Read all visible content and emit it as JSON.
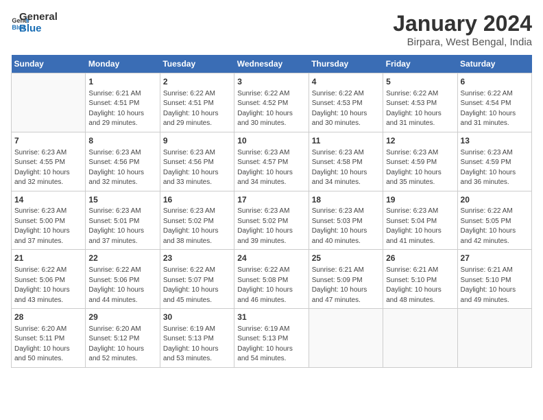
{
  "logo": {
    "line1": "General",
    "line2": "Blue"
  },
  "title": "January 2024",
  "subtitle": "Birpara, West Bengal, India",
  "days_of_week": [
    "Sunday",
    "Monday",
    "Tuesday",
    "Wednesday",
    "Thursday",
    "Friday",
    "Saturday"
  ],
  "weeks": [
    [
      {
        "day": "",
        "info": ""
      },
      {
        "day": "1",
        "info": "Sunrise: 6:21 AM\nSunset: 4:51 PM\nDaylight: 10 hours\nand 29 minutes."
      },
      {
        "day": "2",
        "info": "Sunrise: 6:22 AM\nSunset: 4:51 PM\nDaylight: 10 hours\nand 29 minutes."
      },
      {
        "day": "3",
        "info": "Sunrise: 6:22 AM\nSunset: 4:52 PM\nDaylight: 10 hours\nand 30 minutes."
      },
      {
        "day": "4",
        "info": "Sunrise: 6:22 AM\nSunset: 4:53 PM\nDaylight: 10 hours\nand 30 minutes."
      },
      {
        "day": "5",
        "info": "Sunrise: 6:22 AM\nSunset: 4:53 PM\nDaylight: 10 hours\nand 31 minutes."
      },
      {
        "day": "6",
        "info": "Sunrise: 6:22 AM\nSunset: 4:54 PM\nDaylight: 10 hours\nand 31 minutes."
      }
    ],
    [
      {
        "day": "7",
        "info": "Sunrise: 6:23 AM\nSunset: 4:55 PM\nDaylight: 10 hours\nand 32 minutes."
      },
      {
        "day": "8",
        "info": "Sunrise: 6:23 AM\nSunset: 4:56 PM\nDaylight: 10 hours\nand 32 minutes."
      },
      {
        "day": "9",
        "info": "Sunrise: 6:23 AM\nSunset: 4:56 PM\nDaylight: 10 hours\nand 33 minutes."
      },
      {
        "day": "10",
        "info": "Sunrise: 6:23 AM\nSunset: 4:57 PM\nDaylight: 10 hours\nand 34 minutes."
      },
      {
        "day": "11",
        "info": "Sunrise: 6:23 AM\nSunset: 4:58 PM\nDaylight: 10 hours\nand 34 minutes."
      },
      {
        "day": "12",
        "info": "Sunrise: 6:23 AM\nSunset: 4:59 PM\nDaylight: 10 hours\nand 35 minutes."
      },
      {
        "day": "13",
        "info": "Sunrise: 6:23 AM\nSunset: 4:59 PM\nDaylight: 10 hours\nand 36 minutes."
      }
    ],
    [
      {
        "day": "14",
        "info": "Sunrise: 6:23 AM\nSunset: 5:00 PM\nDaylight: 10 hours\nand 37 minutes."
      },
      {
        "day": "15",
        "info": "Sunrise: 6:23 AM\nSunset: 5:01 PM\nDaylight: 10 hours\nand 37 minutes."
      },
      {
        "day": "16",
        "info": "Sunrise: 6:23 AM\nSunset: 5:02 PM\nDaylight: 10 hours\nand 38 minutes."
      },
      {
        "day": "17",
        "info": "Sunrise: 6:23 AM\nSunset: 5:02 PM\nDaylight: 10 hours\nand 39 minutes."
      },
      {
        "day": "18",
        "info": "Sunrise: 6:23 AM\nSunset: 5:03 PM\nDaylight: 10 hours\nand 40 minutes."
      },
      {
        "day": "19",
        "info": "Sunrise: 6:23 AM\nSunset: 5:04 PM\nDaylight: 10 hours\nand 41 minutes."
      },
      {
        "day": "20",
        "info": "Sunrise: 6:22 AM\nSunset: 5:05 PM\nDaylight: 10 hours\nand 42 minutes."
      }
    ],
    [
      {
        "day": "21",
        "info": "Sunrise: 6:22 AM\nSunset: 5:06 PM\nDaylight: 10 hours\nand 43 minutes."
      },
      {
        "day": "22",
        "info": "Sunrise: 6:22 AM\nSunset: 5:06 PM\nDaylight: 10 hours\nand 44 minutes."
      },
      {
        "day": "23",
        "info": "Sunrise: 6:22 AM\nSunset: 5:07 PM\nDaylight: 10 hours\nand 45 minutes."
      },
      {
        "day": "24",
        "info": "Sunrise: 6:22 AM\nSunset: 5:08 PM\nDaylight: 10 hours\nand 46 minutes."
      },
      {
        "day": "25",
        "info": "Sunrise: 6:21 AM\nSunset: 5:09 PM\nDaylight: 10 hours\nand 47 minutes."
      },
      {
        "day": "26",
        "info": "Sunrise: 6:21 AM\nSunset: 5:10 PM\nDaylight: 10 hours\nand 48 minutes."
      },
      {
        "day": "27",
        "info": "Sunrise: 6:21 AM\nSunset: 5:10 PM\nDaylight: 10 hours\nand 49 minutes."
      }
    ],
    [
      {
        "day": "28",
        "info": "Sunrise: 6:20 AM\nSunset: 5:11 PM\nDaylight: 10 hours\nand 50 minutes."
      },
      {
        "day": "29",
        "info": "Sunrise: 6:20 AM\nSunset: 5:12 PM\nDaylight: 10 hours\nand 52 minutes."
      },
      {
        "day": "30",
        "info": "Sunrise: 6:19 AM\nSunset: 5:13 PM\nDaylight: 10 hours\nand 53 minutes."
      },
      {
        "day": "31",
        "info": "Sunrise: 6:19 AM\nSunset: 5:13 PM\nDaylight: 10 hours\nand 54 minutes."
      },
      {
        "day": "",
        "info": ""
      },
      {
        "day": "",
        "info": ""
      },
      {
        "day": "",
        "info": ""
      }
    ]
  ]
}
